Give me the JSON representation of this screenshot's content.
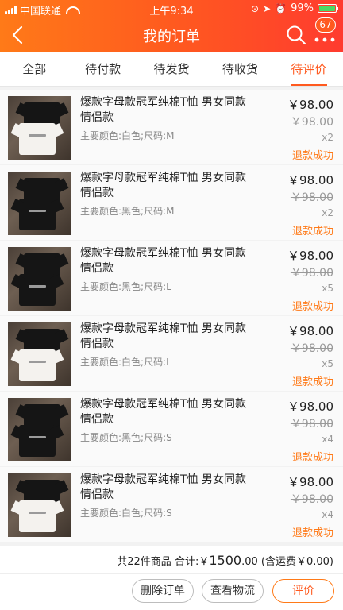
{
  "status_bar": {
    "carrier": "中国联通",
    "time": "上午9:34",
    "battery_percent": "99%",
    "battery_level": 0.99,
    "icons": [
      "signal-icon",
      "wifi-icon",
      "lock-rotation-icon",
      "location-icon",
      "alarm-icon",
      "battery-icon"
    ]
  },
  "nav": {
    "title": "我的订单",
    "badge_count": "67",
    "icons": [
      "back-icon",
      "search-icon",
      "more-icon"
    ]
  },
  "tabs": [
    {
      "label": "全部",
      "active": false
    },
    {
      "label": "待付款",
      "active": false
    },
    {
      "label": "待发货",
      "active": false
    },
    {
      "label": "待收货",
      "active": false
    },
    {
      "label": "待评价",
      "active": true
    }
  ],
  "items": [
    {
      "name": "爆款字母款冠军纯棉T恤 男女同款情侣款",
      "spec": "主要颜色:白色;尺码:M",
      "price": "￥98.00",
      "original_price": "￥98.00",
      "qty": "x2",
      "status": "退款成功",
      "image": "black-white-tshirt-pair"
    },
    {
      "name": "爆款字母款冠军纯棉T恤 男女同款情侣款",
      "spec": "主要颜色:黑色;尺码:M",
      "price": "￥98.00",
      "original_price": "￥98.00",
      "qty": "x2",
      "status": "退款成功",
      "image": "black-tshirt-pair"
    },
    {
      "name": "爆款字母款冠军纯棉T恤 男女同款情侣款",
      "spec": "主要颜色:黑色;尺码:L",
      "price": "￥98.00",
      "original_price": "￥98.00",
      "qty": "x5",
      "status": "退款成功",
      "image": "black-tshirt-pair"
    },
    {
      "name": "爆款字母款冠军纯棉T恤 男女同款情侣款",
      "spec": "主要颜色:白色;尺码:L",
      "price": "￥98.00",
      "original_price": "￥98.00",
      "qty": "x5",
      "status": "退款成功",
      "image": "black-white-tshirt-pair"
    },
    {
      "name": "爆款字母款冠军纯棉T恤 男女同款情侣款",
      "spec": "主要颜色:黑色;尺码:S",
      "price": "￥98.00",
      "original_price": "￥98.00",
      "qty": "x4",
      "status": "退款成功",
      "image": "black-tshirt-pair"
    },
    {
      "name": "爆款字母款冠军纯棉T恤 男女同款情侣款",
      "spec": "主要颜色:白色;尺码:S",
      "price": "￥98.00",
      "original_price": "￥98.00",
      "qty": "x4",
      "status": "退款成功",
      "image": "black-white-tshirt-pair"
    }
  ],
  "summary": {
    "count_text": "共22件商品",
    "total_label": "合计:",
    "currency": "￥",
    "total_int": "1500",
    "total_dec": ".00",
    "shipping_text": "(含运费￥0.00)"
  },
  "actions": {
    "delete_label": "删除订单",
    "logistics_label": "查看物流",
    "review_label": "评价"
  },
  "colors": {
    "accent": "#ff5a1f",
    "header_start": "#ff7a18",
    "header_end": "#ff3b2f",
    "status": "#ff7a18"
  }
}
